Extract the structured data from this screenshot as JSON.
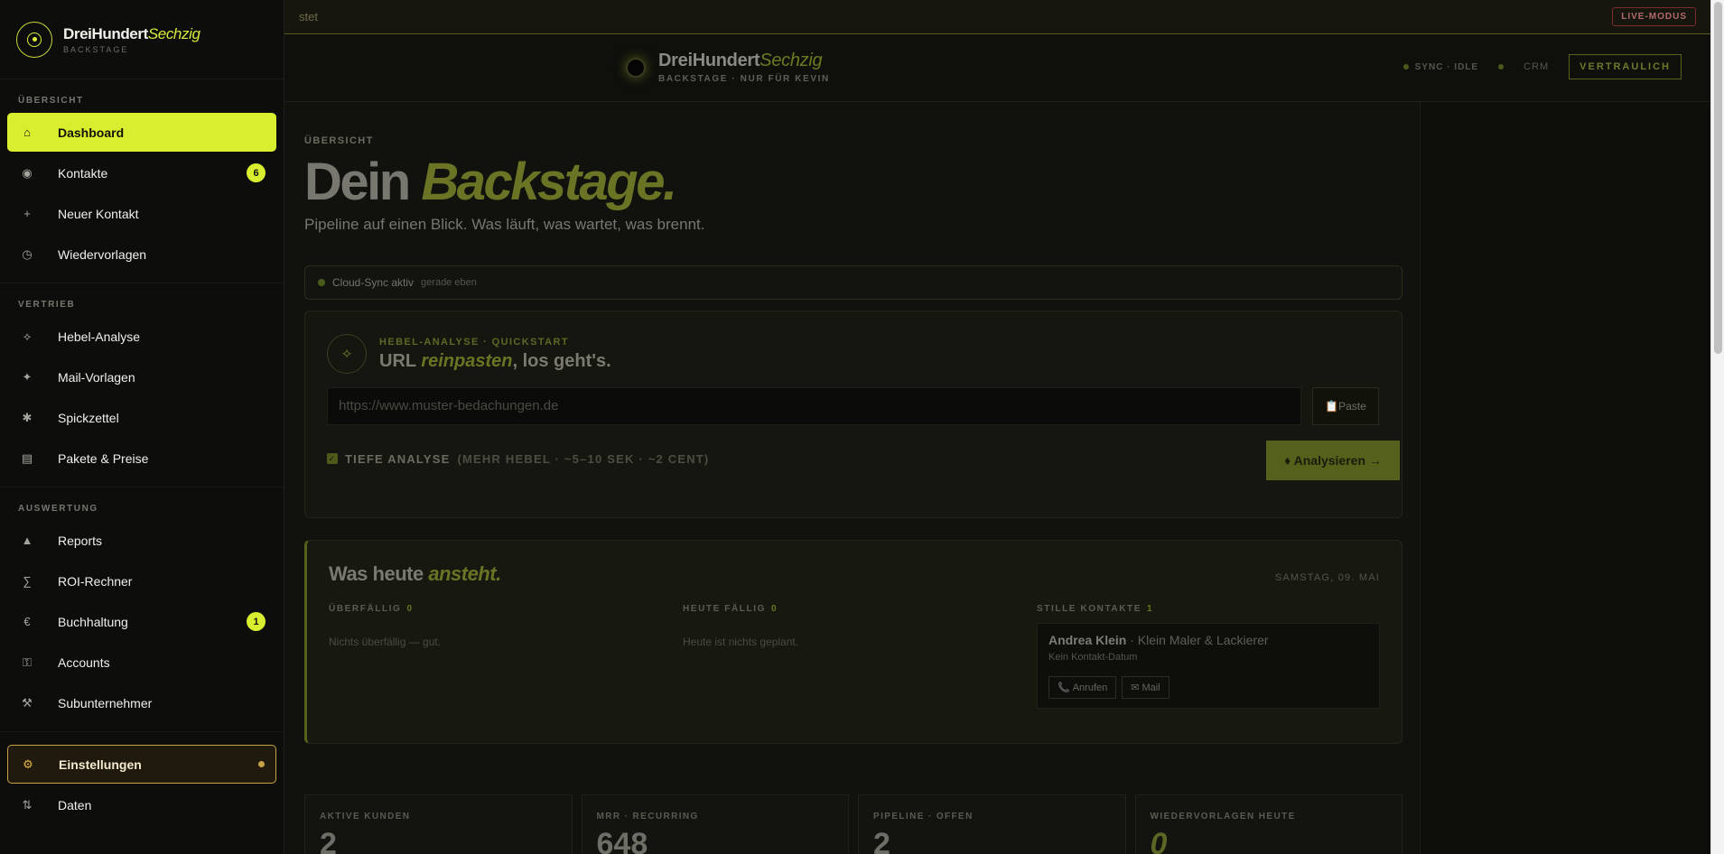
{
  "banner": {
    "fragment": "stet",
    "live_badge": "LIVE-MODUS"
  },
  "header": {
    "brand_main": "DreiHundert",
    "brand_accent": "Sechzig",
    "brand_sub": "BACKSTAGE · NUR FÜR KEVIN",
    "sync": "SYNC · IDLE",
    "crm": "CRM",
    "confidential": "VERTRAULICH"
  },
  "sidebar": {
    "brand_main": "DreiHundert",
    "brand_accent": "Sechzig",
    "brand_sub": "BACKSTAGE",
    "sections": [
      {
        "label": "ÜBERSICHT",
        "items": [
          {
            "label": "Dashboard",
            "icon": "⌂",
            "icon_name": "home-icon",
            "active": true
          },
          {
            "label": "Kontakte",
            "icon": "◉",
            "icon_name": "contacts-icon",
            "badge": "6"
          },
          {
            "label": "Neuer Kontakt",
            "icon": "+",
            "icon_name": "plus-icon"
          },
          {
            "label": "Wiedervorlagen",
            "icon": "◷",
            "icon_name": "clock-icon"
          }
        ]
      },
      {
        "label": "VERTRIEB",
        "items": [
          {
            "label": "Hebel-Analyse",
            "icon": "⟡",
            "icon_name": "lever-icon"
          },
          {
            "label": "Mail-Vorlagen",
            "icon": "✦",
            "icon_name": "sparkle-icon"
          },
          {
            "label": "Spickzettel",
            "icon": "✱",
            "icon_name": "asterisk-icon"
          },
          {
            "label": "Pakete & Preise",
            "icon": "▤",
            "icon_name": "list-icon"
          }
        ]
      },
      {
        "label": "AUSWERTUNG",
        "items": [
          {
            "label": "Reports",
            "icon": "▲",
            "icon_name": "chart-icon"
          },
          {
            "label": "ROI-Rechner",
            "icon": "∑",
            "icon_name": "sum-icon"
          },
          {
            "label": "Buchhaltung",
            "icon": "€",
            "icon_name": "euro-icon",
            "badge": "1"
          },
          {
            "label": "Accounts",
            "icon": "⚿",
            "icon_name": "key-icon"
          },
          {
            "label": "Subunternehmer",
            "icon": "⚒",
            "icon_name": "tools-icon"
          }
        ]
      }
    ],
    "settings": {
      "label": "Einstellungen",
      "icon": "⚙"
    },
    "data": {
      "label": "Daten",
      "icon": "⇅"
    }
  },
  "main": {
    "eyebrow": "ÜBERSICHT",
    "hero_main": "Dein ",
    "hero_accent": "Backstage.",
    "hero_sub": "Pipeline auf einen Blick. Was läuft, was wartet, was brennt.",
    "sync_status": "Cloud-Sync aktiv",
    "sync_time": "gerade eben",
    "quick": {
      "icon": "⟡",
      "eyebrow": "HEBEL-ANALYSE · QUICKSTART",
      "title_1": "URL ",
      "title_accent": "reinpasten",
      "title_2": ", los geht's.",
      "url_placeholder": "https://www.muster-bedachungen.de",
      "paste_label": "📋Paste",
      "deep_label": "TIEFE ANALYSE",
      "deep_hint": "(MEHR HEBEL · ~5–10 SEK · ~2 CENT)",
      "deep_checked": true,
      "analyse_label": "♦ Analysieren →"
    },
    "today": {
      "title_1": "Was heute ",
      "title_accent": "ansteht.",
      "date": "SAMSTAG, 09. MAI",
      "overdue_label": "ÜBERFÄLLIG",
      "overdue_count": "0",
      "overdue_empty": "Nichts überfällig — gut.",
      "due_label": "HEUTE FÄLLIG",
      "due_count": "0",
      "due_empty": "Heute ist nichts geplant.",
      "silent_label": "STILLE KONTAKTE",
      "silent_count": "1",
      "contact": {
        "name": "Andrea Klein",
        "company": " · Klein Maler & Lackierer",
        "status": "Kein Kontakt-Datum",
        "call_label": "Anrufen",
        "mail_label": "Mail"
      }
    },
    "stats": [
      {
        "label": "AKTIVE KUNDEN",
        "value": "2"
      },
      {
        "label": "MRR · RECURRING",
        "value": "648"
      },
      {
        "label": "PIPELINE · OFFEN",
        "value": "2"
      },
      {
        "label": "WIEDERVORLAGEN HEUTE",
        "value": "0"
      }
    ]
  }
}
